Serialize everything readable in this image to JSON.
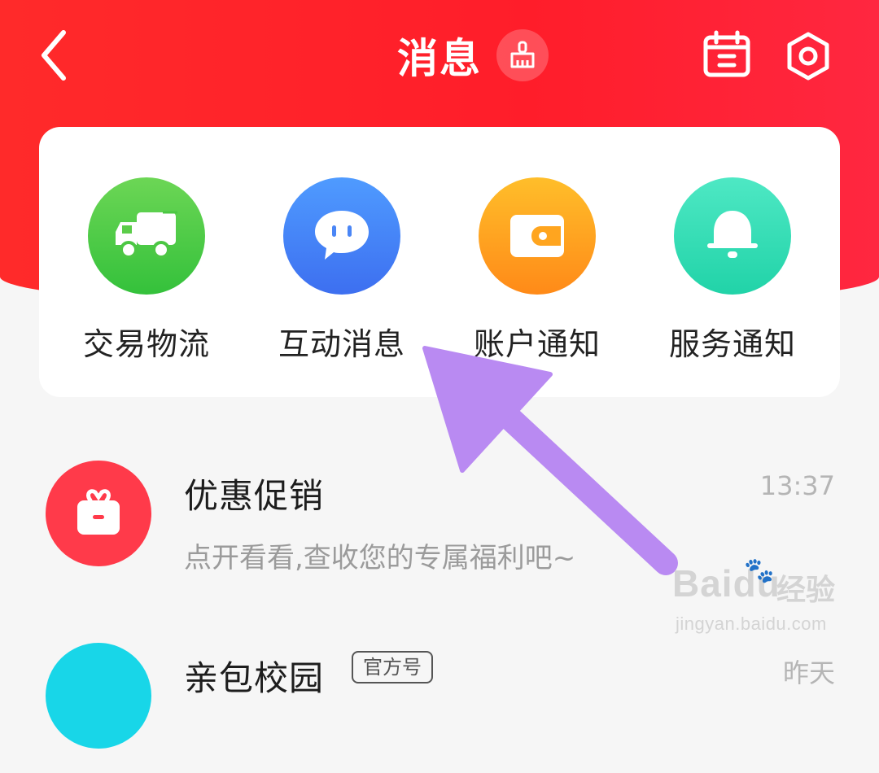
{
  "colors": {
    "header_red": "#ff2a2a",
    "arrow_purple": "#b98af2",
    "green": "#34c13b",
    "blue": "#3d6ff0",
    "orange": "#ff8a18",
    "teal": "#21d3a8",
    "promo_red": "#ff3a4a",
    "cyan": "#18d6e8"
  },
  "header": {
    "title": "消息",
    "icons": [
      "back-arrow-icon",
      "broom-icon",
      "calendar-icon",
      "settings-icon"
    ]
  },
  "quick_actions": [
    {
      "label": "交易物流",
      "icon": "truck-icon",
      "color": "green"
    },
    {
      "label": "互动消息",
      "icon": "chat-bubble-icon",
      "color": "blue"
    },
    {
      "label": "账户通知",
      "icon": "wallet-icon",
      "color": "orange"
    },
    {
      "label": "服务通知",
      "icon": "bell-icon",
      "color": "teal"
    }
  ],
  "messages": [
    {
      "title": "优惠促销",
      "time": "13:37",
      "preview": "点开看看,查收您的专属福利吧~",
      "icon": "gift-box-icon"
    },
    {
      "title": "亲包校园",
      "tag": "官方号",
      "time": "昨天",
      "icon": "avatar-icon"
    }
  ],
  "watermark": {
    "logo": "Bai",
    "logo2": "du",
    "cn": "经验",
    "url": "jingyan.baidu.com"
  }
}
